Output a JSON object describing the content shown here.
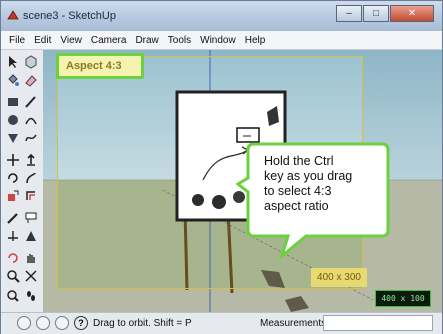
{
  "window": {
    "title": "scene3 - SketchUp"
  },
  "menu": [
    "File",
    "Edit",
    "View",
    "Camera",
    "Draw",
    "Tools",
    "Window",
    "Help"
  ],
  "callouts": {
    "aspect_label": "Aspect 4:3",
    "speech": "Hold the Ctrl\nkey as you drag\nto select 4:3\naspect ratio"
  },
  "viewport": {
    "dimension_badge": "400 x 300",
    "vcb_preview": "400 x 100"
  },
  "status": {
    "hint": "Drag to orbit.  Shift = P",
    "measurements_label": "Measurements",
    "measurements_value": ""
  },
  "colors": {
    "frame": "#d6c13a",
    "callout_border": "#6bd13f",
    "speech_border": "#6bd13f"
  }
}
